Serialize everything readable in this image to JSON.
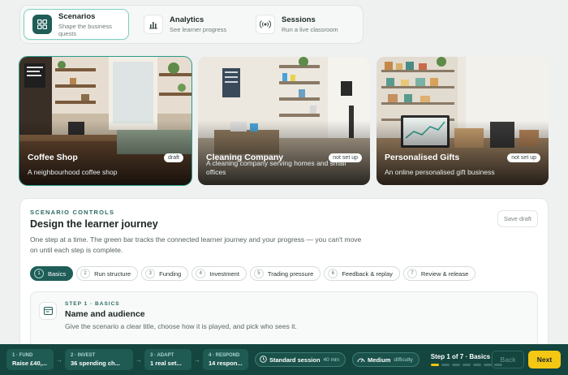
{
  "nav": {
    "tabs": [
      {
        "title": "Scenarios",
        "subtitle": "Shape the business quests",
        "icon": "grid-icon",
        "active": true
      },
      {
        "title": "Analytics",
        "subtitle": "See learner progress",
        "icon": "bar-chart-icon",
        "active": false
      },
      {
        "title": "Sessions",
        "subtitle": "Run a live classroom",
        "icon": "broadcast-icon",
        "active": false
      }
    ]
  },
  "cards": [
    {
      "title": "Coffee Shop",
      "description": "A neighbourhood coffee shop",
      "badge": "draft",
      "selected": true
    },
    {
      "title": "Cleaning Company",
      "description": "A cleaning company serving homes and small offices",
      "badge": "not set up",
      "selected": false
    },
    {
      "title": "Personalised Gifts",
      "description": "An online personalised gift business",
      "badge": "not set up",
      "selected": false
    }
  ],
  "panel": {
    "eyebrow": "SCENARIO CONTROLS",
    "title": "Design the learner journey",
    "description": "One step at a time. The green bar tracks the connected learner journey and your progress — you can't move on until each step is complete.",
    "save_draft": "Save draft",
    "steps": [
      {
        "num": "1",
        "label": "Basics",
        "active": true
      },
      {
        "num": "2",
        "label": "Run structure",
        "active": false
      },
      {
        "num": "3",
        "label": "Funding",
        "active": false
      },
      {
        "num": "4",
        "label": "Investment",
        "active": false
      },
      {
        "num": "5",
        "label": "Trading pressure",
        "active": false
      },
      {
        "num": "6",
        "label": "Feedback & replay",
        "active": false
      },
      {
        "num": "7",
        "label": "Review & release",
        "active": false
      }
    ],
    "current_step": {
      "label": "STEP 1 · BASICS",
      "title": "Name and audience",
      "description": "Give the scenario a clear title, choose how it is played, and pick who sees it."
    }
  },
  "bottombar": {
    "journey": [
      {
        "label": "1 · FUND",
        "value": "Raise £40,..."
      },
      {
        "label": "2 · INVEST",
        "value": "36 spending ch..."
      },
      {
        "label": "3 · ADAPT",
        "value": "1 real set..."
      },
      {
        "label": "4 · RESPOND",
        "value": "14 respon..."
      }
    ],
    "session": {
      "value": "Standard session",
      "meta": "40 min"
    },
    "difficulty": {
      "value": "Medium",
      "meta": "difficulty"
    },
    "progress_text": "Step 1 of 7 · Basics",
    "progress_completed": 1,
    "progress_total": 7,
    "back_label": "Back",
    "next_label": "Next"
  },
  "colors": {
    "accent": "#1f5d58",
    "bar": "#14453f",
    "next": "#f3c713"
  }
}
